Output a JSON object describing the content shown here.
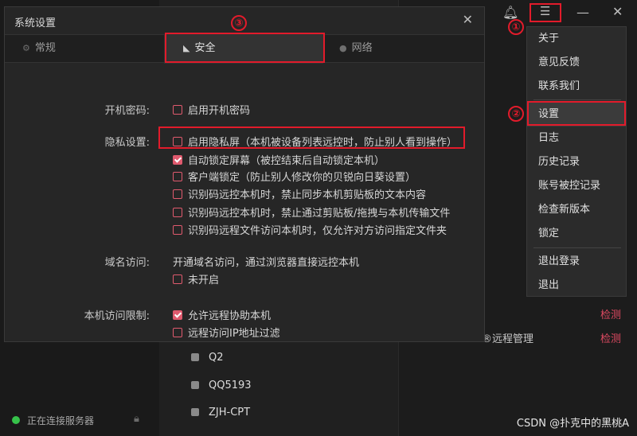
{
  "background": {
    "status_text": "正在连接服务器",
    "devices": [
      "Q2",
      "QQ5193",
      "ZJH-CPT"
    ],
    "remote_mgmt": "®远程管理",
    "detect_label": "检测"
  },
  "dialog": {
    "title": "系统设置",
    "tabs": [
      {
        "label": "常规",
        "icon": "gear-icon"
      },
      {
        "label": "安全",
        "icon": "shield-icon"
      },
      {
        "label": "网络",
        "icon": "globe-icon"
      }
    ],
    "boot_password": {
      "label": "开机密码:",
      "option": "启用开机密码"
    },
    "privacy": {
      "label": "隐私设置:",
      "options": [
        {
          "text": "启用隐私屏（本机被设备列表远控时，防止别人看到操作）",
          "checked": false
        },
        {
          "text": "自动锁定屏幕（被控结束后自动锁定本机）",
          "checked": true
        },
        {
          "text": "客户端锁定（防止别人修改你的贝锐向日葵设置）",
          "checked": false
        },
        {
          "text": "识别码远控本机时，禁止同步本机剪贴板的文本内容",
          "checked": false
        },
        {
          "text": "识别码远控本机时，禁止通过剪贴板/拖拽与本机传输文件",
          "checked": false
        },
        {
          "text": "识别码远程文件访问本机时，仅允许对方访问指定文件夹",
          "checked": false
        }
      ]
    },
    "domain": {
      "label": "域名访问:",
      "desc": "开通域名访问，通过浏览器直接远控本机",
      "option": "未开启"
    },
    "access": {
      "label": "本机访问限制:",
      "options": [
        {
          "text": "允许远程协助本机",
          "checked": true
        },
        {
          "text": "远程访问IP地址过滤",
          "checked": false
        }
      ]
    }
  },
  "menu": {
    "items": [
      "关于",
      "意见反馈",
      "联系我们",
      "设置",
      "日志",
      "历史记录",
      "账号被控记录",
      "检查新版本",
      "锁定",
      "退出登录",
      "退出"
    ],
    "selected": "设置"
  },
  "markers": [
    "①",
    "②",
    "③"
  ],
  "watermark": "CSDN @扑克中的黑桃A"
}
